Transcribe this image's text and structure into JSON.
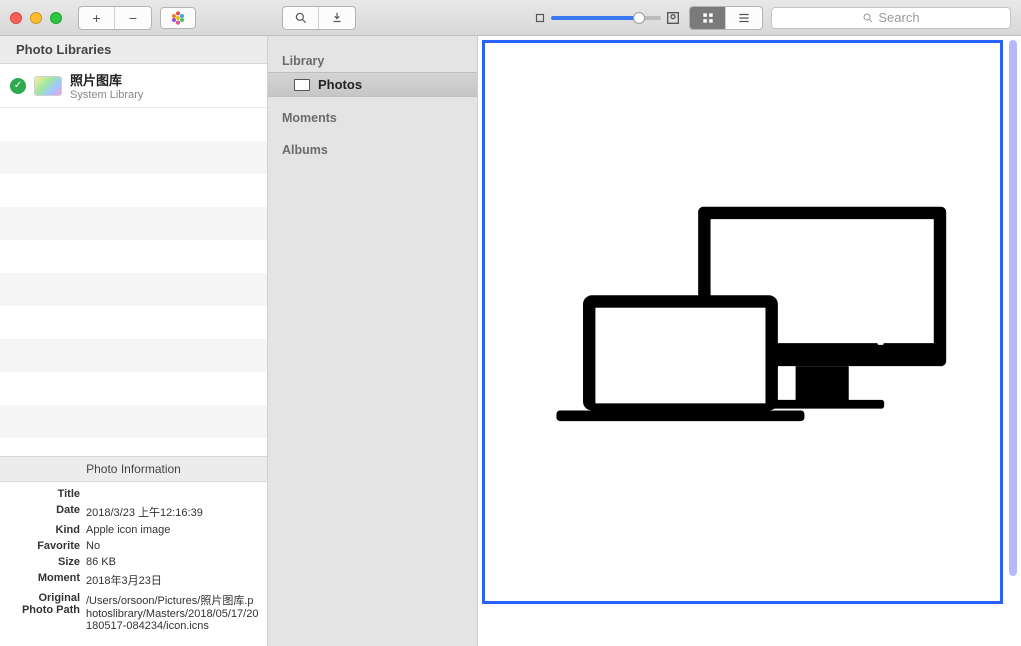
{
  "toolbar": {
    "search_placeholder": "Search"
  },
  "sidebar": {
    "header": "Photo Libraries",
    "library": {
      "title": "照片图库",
      "subtitle": "System Library"
    },
    "info_header": "Photo Information",
    "info": {
      "title_k": "Title",
      "title_v": "",
      "date_k": "Date",
      "date_v": "2018/3/23 上午12:16:39",
      "kind_k": "Kind",
      "kind_v": "Apple icon image",
      "favorite_k": "Favorite",
      "favorite_v": "No",
      "size_k": "Size",
      "size_v": "86 KB",
      "moment_k": "Moment",
      "moment_v": "2018年3月23日",
      "path_k": "Original Photo Path",
      "path_v": "/Users/orsoon/Pictures/照片图库.photoslibrary/Masters/2018/05/17/20180517-084234/icon.icns"
    }
  },
  "mid": {
    "library_label": "Library",
    "photos_label": "Photos",
    "moments_label": "Moments",
    "albums_label": "Albums"
  }
}
